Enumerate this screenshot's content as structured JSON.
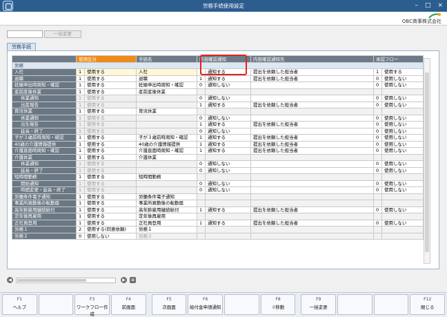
{
  "window": {
    "title": "労務手続使用設定",
    "controls": [
      "–",
      "□",
      "×"
    ]
  },
  "header": {
    "company": "OBC商事株式会社",
    "brand_mark": "AI-logo"
  },
  "toolbar": {
    "field_value": "",
    "button_label": "一括変更"
  },
  "tab": {
    "label": "労務手続"
  },
  "columns": [
    "使用区分",
    "手続名",
    "内容確認通知",
    "内容確認通知先",
    "承認フロー"
  ],
  "rows": [
    {
      "type": "group",
      "name": "労務"
    },
    {
      "name": "入社",
      "u_num": "1",
      "u_label": "使用する",
      "form": "入社",
      "n_num": "1",
      "n_label": "通知する",
      "dest": "提出を依頼した担当者",
      "a_num": "1",
      "a_label": "使用する",
      "sel": true
    },
    {
      "name": "退職",
      "u_num": "1",
      "u_label": "使用する",
      "form": "退職",
      "n_num": "1",
      "n_label": "通知する",
      "dest": "提出を依頼した担当者",
      "a_num": "0",
      "a_label": "使用しない"
    },
    {
      "name": "妊娠申出時周知・確認",
      "u_num": "1",
      "u_label": "使用する",
      "form": "妊娠申出時周知・確認",
      "n_num": "0",
      "n_label": "通知しない",
      "dest": "",
      "a_num": "0",
      "a_label": "使用しない"
    },
    {
      "name": "産前産後休業",
      "u_num": "1",
      "u_label": "使用する",
      "form": "産前産後休業",
      "n_num": "",
      "n_label": "",
      "dest": "",
      "a_num": "",
      "a_label": ""
    },
    {
      "name": "休業通知",
      "sub": true,
      "dim": true,
      "u_num": "1",
      "u_label": "使用する",
      "form": "",
      "n_num": "0",
      "n_label": "通知しない",
      "dest": "",
      "a_num": "0",
      "a_label": "使用しない"
    },
    {
      "name": "出産報告",
      "sub": true,
      "dim": true,
      "u_num": "1",
      "u_label": "使用する",
      "form": "",
      "n_num": "1",
      "n_label": "通知する",
      "dest": "提出を依頼した担当者",
      "a_num": "0",
      "a_label": "使用しない"
    },
    {
      "name": "育児休業",
      "u_num": "1",
      "u_label": "使用する",
      "form": "育児休業",
      "n_num": "",
      "n_label": "",
      "dest": "",
      "a_num": "",
      "a_label": ""
    },
    {
      "name": "休業通知",
      "sub": true,
      "dim": true,
      "u_num": "1",
      "u_label": "使用する",
      "form": "",
      "n_num": "0",
      "n_label": "通知しない",
      "dest": "",
      "a_num": "0",
      "a_label": "使用しない"
    },
    {
      "name": "出生報告",
      "sub": true,
      "dim": true,
      "u_num": "1",
      "u_label": "使用する",
      "form": "",
      "n_num": "1",
      "n_label": "通知する",
      "dest": "提出を依頼した担当者",
      "a_num": "0",
      "a_label": "使用しない"
    },
    {
      "name": "延長・終了",
      "sub": true,
      "dim": true,
      "u_num": "1",
      "u_label": "使用する",
      "form": "",
      "n_num": "0",
      "n_label": "通知しない",
      "dest": "",
      "a_num": "0",
      "a_label": "使用しない"
    },
    {
      "name": "子が３歳前時周知・確認",
      "u_num": "1",
      "u_label": "使用する",
      "form": "子が３歳前時周知・確認",
      "n_num": "1",
      "n_label": "通知する",
      "dest": "提出を依頼した担当者",
      "a_num": "0",
      "a_label": "使用しない"
    },
    {
      "name": "40歳の介護情報提供",
      "u_num": "1",
      "u_label": "使用する",
      "form": "40歳の介護情報提供",
      "n_num": "1",
      "n_label": "通知する",
      "dest": "提出を依頼した担当者",
      "a_num": "0",
      "a_label": "使用しない"
    },
    {
      "name": "介護直面時周知・確認",
      "u_num": "1",
      "u_label": "使用する",
      "form": "介護直面時周知・確認",
      "n_num": "1",
      "n_label": "通知する",
      "dest": "提出を依頼した担当者",
      "a_num": "0",
      "a_label": "使用しない"
    },
    {
      "name": "介護休業",
      "u_num": "1",
      "u_label": "使用する",
      "form": "介護休業",
      "n_num": "",
      "n_label": "",
      "dest": "",
      "a_num": "",
      "a_label": ""
    },
    {
      "name": "休業通知",
      "sub": true,
      "dim": true,
      "u_num": "1",
      "u_label": "使用する",
      "form": "",
      "n_num": "0",
      "n_label": "通知しない",
      "dest": "",
      "a_num": "0",
      "a_label": "使用しない"
    },
    {
      "name": "延長・終了",
      "sub": true,
      "dim": true,
      "u_num": "1",
      "u_label": "使用する",
      "form": "",
      "n_num": "0",
      "n_label": "通知しない",
      "dest": "",
      "a_num": "0",
      "a_label": "使用しない"
    },
    {
      "name": "短時間勤務",
      "u_num": "1",
      "u_label": "使用する",
      "form": "短時間勤務",
      "n_num": "",
      "n_label": "",
      "dest": "",
      "a_num": "",
      "a_label": ""
    },
    {
      "name": "開始通知",
      "sub": true,
      "dim": true,
      "u_num": "1",
      "u_label": "使用する",
      "form": "",
      "n_num": "0",
      "n_label": "通知しない",
      "dest": "",
      "a_num": "0",
      "a_label": "使用しない"
    },
    {
      "name": "時間変更・延長・終了",
      "sub": true,
      "dim": true,
      "u_num": "1",
      "u_label": "使用する",
      "form": "",
      "n_num": "0",
      "n_label": "通知しない",
      "dest": "",
      "a_num": "0",
      "a_label": "使用しない"
    },
    {
      "name": "労働条件電子通知",
      "u_num": "1",
      "u_label": "使用する",
      "form": "労働条件電子通知",
      "n_num": "",
      "n_label": "",
      "dest": "",
      "a_num": "",
      "a_label": ""
    },
    {
      "name": "事業所異動後の転勤届",
      "u_num": "1",
      "u_label": "使用する",
      "form": "事業所異動後の転勤届",
      "n_num": "",
      "n_label": "",
      "dest": "",
      "a_num": "",
      "a_label": ""
    },
    {
      "name": "高年齢雇用継続給付",
      "u_num": "1",
      "u_label": "使用する",
      "form": "高年齢雇用継続給付",
      "n_num": "1",
      "n_label": "通知する",
      "dest": "提出を依頼した担当者",
      "a_num": "0",
      "a_label": "使用しない"
    },
    {
      "name": "定年後再雇用",
      "u_num": "1",
      "u_label": "使用する",
      "form": "定年後再雇用",
      "n_num": "",
      "n_label": "",
      "dest": "",
      "a_num": "",
      "a_label": ""
    },
    {
      "name": "正社員登用",
      "u_num": "1",
      "u_label": "使用する",
      "form": "正社員登用",
      "n_num": "1",
      "n_label": "通知する",
      "dest": "提出を依頼した担当者",
      "a_num": "0",
      "a_label": "使用しない"
    },
    {
      "name": "労務１",
      "u_num": "2",
      "u_label": "使用する(同意依頼)",
      "form": "労務１",
      "n_num": "",
      "n_label": "",
      "dest": "",
      "a_num": "",
      "a_label": ""
    },
    {
      "name": "労務２",
      "u_num": "0",
      "u_label": "使用しない",
      "form": "労務２",
      "dimform": true,
      "n_num": "",
      "n_label": "",
      "dest": "",
      "a_num": "",
      "a_label": ""
    }
  ],
  "fkeys": [
    {
      "key": "F1",
      "label": "ヘルプ"
    },
    {
      "key": "",
      "label": ""
    },
    {
      "key": "F3",
      "label": "ワークフロー作成"
    },
    {
      "key": "F4",
      "label": "前画面"
    },
    {
      "key": "F5",
      "label": "次画面"
    },
    {
      "key": "F6",
      "label": "給付金申請通知"
    },
    {
      "key": "",
      "label": ""
    },
    {
      "key": "F8",
      "label": "⇩移動"
    },
    {
      "key": "F9",
      "label": "一括変更"
    },
    {
      "key": "",
      "label": ""
    },
    {
      "key": "",
      "label": ""
    },
    {
      "key": "F12",
      "label": "閉じる"
    }
  ]
}
